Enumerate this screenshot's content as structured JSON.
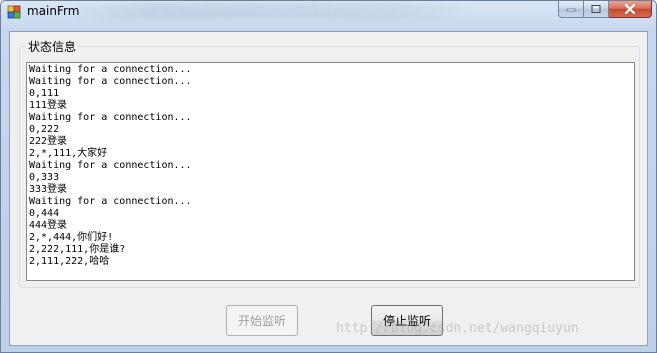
{
  "window": {
    "title": "mainFrm"
  },
  "group": {
    "label": "状态信息"
  },
  "log": {
    "lines": [
      "Waiting for a connection...",
      "Waiting for a connection...",
      "0,111",
      "111登录",
      "Waiting for a connection...",
      "0,222",
      "222登录",
      "2,*,111,大家好",
      "Waiting for a connection...",
      "0,333",
      "333登录",
      "Waiting for a connection...",
      "0,444",
      "444登录",
      "2,*,444,你们好!",
      "2,222,111,你是谁?",
      "2,111,222,哈哈"
    ]
  },
  "buttons": {
    "start_label": "开始监听",
    "start_enabled": false,
    "stop_label": "停止监听",
    "stop_enabled": true
  },
  "watermark": "http://blog.csdn.net/wangqiuyun",
  "icons": {
    "app": "app-icon",
    "minimize": "minimize-icon",
    "maximize": "maximize-icon",
    "close": "close-icon"
  },
  "colors": {
    "close_button": "#c44a2f",
    "frame": "#bcd0e8"
  }
}
